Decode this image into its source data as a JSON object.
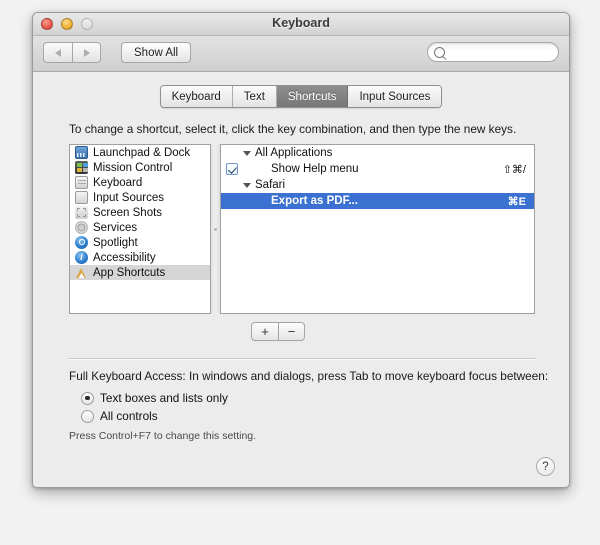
{
  "window": {
    "title": "Keyboard",
    "traffic_lights": [
      "close",
      "minimize",
      "zoom"
    ]
  },
  "toolbar": {
    "back_label": "◀",
    "forward_label": "▶",
    "show_all_label": "Show All",
    "search_value": "",
    "search_placeholder": ""
  },
  "tabs": [
    {
      "label": "Keyboard",
      "active": false
    },
    {
      "label": "Text",
      "active": false
    },
    {
      "label": "Shortcuts",
      "active": true
    },
    {
      "label": "Input Sources",
      "active": false
    }
  ],
  "instruction": "To change a shortcut, select it, click the key combination, and then type the new keys.",
  "sidebar": {
    "items": [
      {
        "label": "Launchpad & Dock",
        "icon": "launchpad-dock-icon",
        "selected": false
      },
      {
        "label": "Mission Control",
        "icon": "mission-control-icon",
        "selected": false
      },
      {
        "label": "Keyboard",
        "icon": "keyboard-icon",
        "selected": false
      },
      {
        "label": "Input Sources",
        "icon": "input-sources-icon",
        "selected": false
      },
      {
        "label": "Screen Shots",
        "icon": "screen-shots-icon",
        "selected": false
      },
      {
        "label": "Services",
        "icon": "services-gear-icon",
        "selected": false
      },
      {
        "label": "Spotlight",
        "icon": "spotlight-icon",
        "selected": false
      },
      {
        "label": "Accessibility",
        "icon": "accessibility-icon",
        "selected": false
      },
      {
        "label": "App Shortcuts",
        "icon": "app-shortcuts-icon",
        "selected": true
      }
    ]
  },
  "shortcuts": {
    "groups": [
      {
        "label": "All Applications",
        "expanded": true,
        "items": [
          {
            "label": "Show Help menu",
            "keys": "⇧⌘/",
            "checked": true,
            "selected": false
          }
        ]
      },
      {
        "label": "Safari",
        "expanded": true,
        "items": [
          {
            "label": "Export as PDF...",
            "keys": "⌘E",
            "checked": false,
            "selected": true
          }
        ]
      }
    ]
  },
  "list_buttons": {
    "add_label": "+",
    "remove_label": "−"
  },
  "full_keyboard_access": {
    "title": "Full Keyboard Access: In windows and dialogs, press Tab to move keyboard focus between:",
    "options": [
      {
        "label": "Text boxes and lists only",
        "selected": true
      },
      {
        "label": "All controls",
        "selected": false
      }
    ],
    "hint": "Press Control+F7 to change this setting."
  },
  "help_button_label": "?",
  "colors": {
    "selection_blue": "#3b72d1",
    "selection_gray": "#d6d6d6",
    "active_tab": "#777777"
  }
}
